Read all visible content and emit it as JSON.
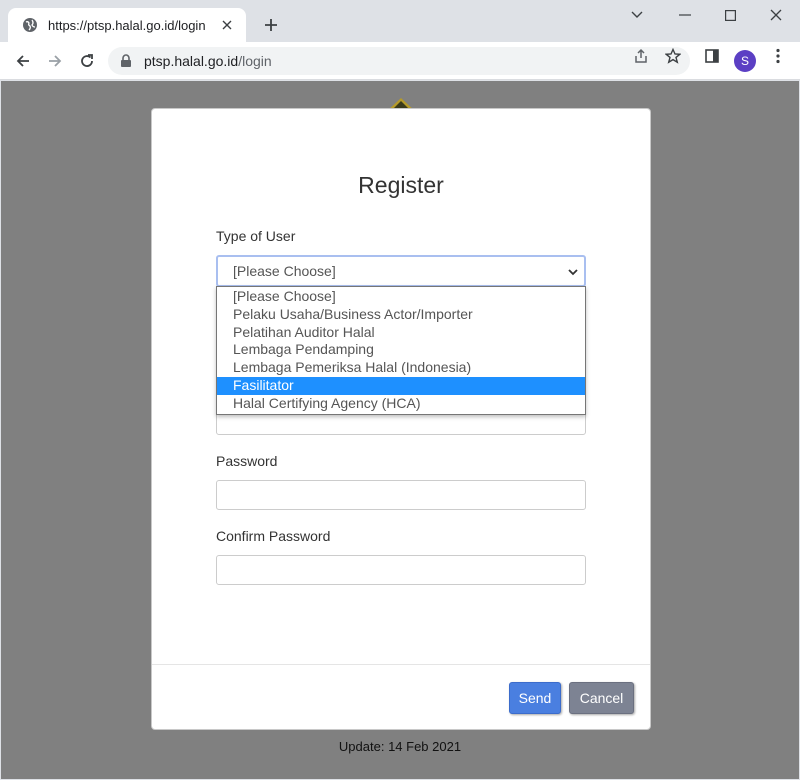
{
  "browser": {
    "tab": {
      "title": "https://ptsp.halal.go.id/login"
    },
    "address": {
      "host": "ptsp.halal.go.id",
      "path": "/login"
    },
    "profile_initial": "S"
  },
  "form": {
    "title": "Register",
    "type_of_user": {
      "label": "Type of User",
      "selected": "[Please Choose]",
      "options": [
        "[Please Choose]",
        "Pelaku Usaha/Business Actor/Importer",
        "Pelatihan Auditor Halal",
        "Lembaga Pendamping",
        "Lembaga Pemeriksa Halal (Indonesia)",
        "Fasilitator",
        "Halal Certifying Agency (HCA)"
      ],
      "highlighted_option": "Fasilitator"
    },
    "password": {
      "label": "Password",
      "value": ""
    },
    "confirm_password": {
      "label": "Confirm Password",
      "value": ""
    },
    "buttons": {
      "send": "Send",
      "cancel": "Cancel"
    }
  },
  "footer": {
    "update": "Update: 14 Feb 2021"
  },
  "colors": {
    "backdrop": "#808080",
    "send_button": "#4a7fe0",
    "cancel_button": "#7d8393",
    "option_highlight": "#1e90ff"
  }
}
